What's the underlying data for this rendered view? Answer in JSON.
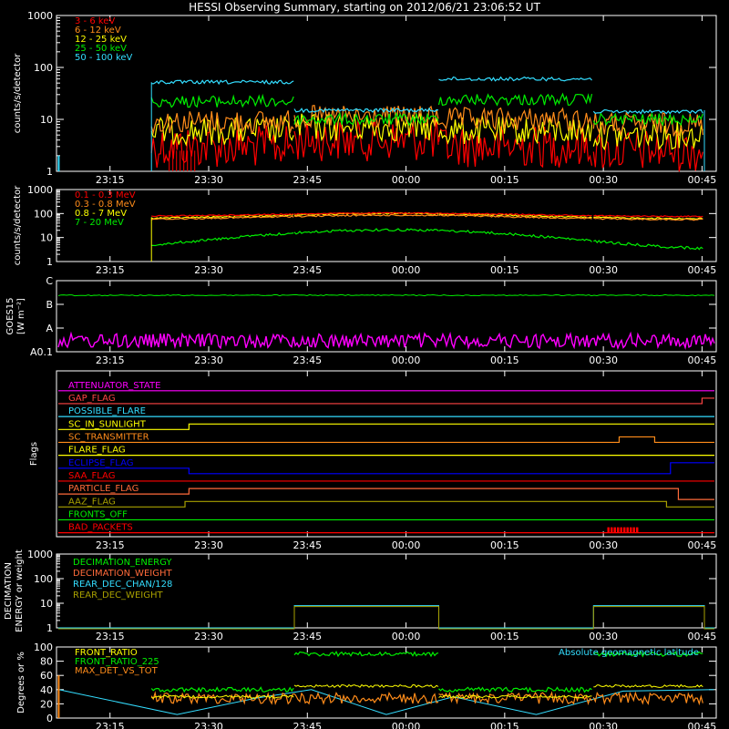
{
  "title": "HESSI Observing Summary, starting on 2012/06/21 23:06:52 UT",
  "time_ticks": [
    "23:15",
    "23:30",
    "23:45",
    "00:00",
    "00:15",
    "00:30",
    "00:45"
  ],
  "colors": {
    "red": "#ff0000",
    "orange": "#ff8c1a",
    "yellow": "#ffff00",
    "green": "#00ee00",
    "cyan": "#33ddff",
    "magenta": "#ff00ff",
    "blue": "#0000ff",
    "olive": "#a8a000",
    "white": "#ffffff",
    "brown": "#ff6a3a"
  },
  "chart_data": [
    {
      "id": "low_energy",
      "type": "line",
      "ylabel": "counts/s/detector",
      "yscale": "log",
      "ylim": [
        1,
        1000
      ],
      "yticks": [
        "1",
        "10",
        "100",
        "1000"
      ],
      "series": [
        {
          "name": "3 - 6 keV",
          "color": "#ff0000",
          "segments": [
            [
              23.35,
              1,
              2.5
            ],
            [
              23.45,
              3,
              4
            ]
          ]
        },
        {
          "name": "6 - 12 keV",
          "color": "#ff8c1a",
          "segments": [
            [
              23.35,
              8,
              10
            ]
          ]
        },
        {
          "name": "12 - 25 keV",
          "color": "#ffff00",
          "segments": [
            [
              23.35,
              5,
              6
            ]
          ]
        },
        {
          "name": "25 - 50 keV",
          "color": "#00ee00",
          "segments": [
            [
              23.35,
              20,
              25
            ],
            [
              23.72,
              10,
              12
            ],
            [
              24.04,
              22,
              28
            ],
            [
              24.47,
              10,
              12
            ]
          ]
        },
        {
          "name": "50 - 100 keV",
          "color": "#33ddff",
          "segments": [
            [
              23.35,
              50,
              55
            ],
            [
              23.72,
              15,
              18
            ],
            [
              24.04,
              60,
              62
            ],
            [
              24.47,
              15,
              17
            ]
          ]
        }
      ],
      "x_start": 23.114,
      "x_end": 24.786
    },
    {
      "id": "high_energy",
      "type": "line",
      "ylabel": "counts/s/detector",
      "yscale": "log",
      "ylim": [
        1,
        1000
      ],
      "yticks": [
        "1",
        "10",
        "100",
        "1000"
      ],
      "series": [
        {
          "name": "0.1 - 0.3 MeV",
          "color": "#ff0000",
          "levels": [
            80,
            100,
            60,
            80,
            100
          ]
        },
        {
          "name": "0.3 - 0.8 MeV",
          "color": "#ff8c1a",
          "levels": [
            60,
            70,
            60,
            70,
            80
          ]
        },
        {
          "name": "0.8 - 7 MeV",
          "color": "#ffff00",
          "levels": [
            60,
            70,
            60,
            70,
            75
          ]
        },
        {
          "name": "7 - 20 MeV",
          "color": "#00ee00",
          "levels": [
            3,
            3,
            20,
            6,
            8
          ]
        }
      ]
    },
    {
      "id": "goes",
      "type": "line",
      "ylabel": "GOES15",
      "ylabel2": "[W m⁻²]",
      "yscale": "log",
      "yticks": [
        "A0.1",
        "A",
        "B",
        "C"
      ],
      "series": [
        {
          "name": "GOES long",
          "color": "#00ee00",
          "level": "B-C"
        },
        {
          "name": "GOES short",
          "color": "#ff00ff",
          "level": "A0.1-A"
        }
      ]
    },
    {
      "id": "flags",
      "type": "table",
      "ylabel": "Flags",
      "flags": [
        {
          "name": "ATTENUATOR_STATE",
          "color": "#ff00ff"
        },
        {
          "name": "GAP_FLAG",
          "color": "#ff4444"
        },
        {
          "name": "POSSIBLE_FLARE",
          "color": "#33ddff"
        },
        {
          "name": "SC_IN_SUNLIGHT",
          "color": "#ffff00"
        },
        {
          "name": "SC_TRANSMITTER",
          "color": "#ff8c1a"
        },
        {
          "name": "FLARE_FLAG",
          "color": "#ffff00"
        },
        {
          "name": "ECLIPSE_FLAG",
          "color": "#0000ff"
        },
        {
          "name": "SAA_FLAG",
          "color": "#ff0000"
        },
        {
          "name": "PARTICLE_FLAG",
          "color": "#ff6a3a"
        },
        {
          "name": "AAZ_FLAG",
          "color": "#a8a000"
        },
        {
          "name": "FRONTS_OFF",
          "color": "#00ee00"
        },
        {
          "name": "BAD_PACKETS",
          "color": "#ff0000"
        }
      ]
    },
    {
      "id": "decimation",
      "type": "line",
      "ylabel": "DECIMATION",
      "ylabel2": "ENERGY or weight",
      "yscale": "log",
      "ylim": [
        1,
        1000
      ],
      "yticks": [
        "1",
        "10",
        "100",
        "1000"
      ],
      "series": [
        {
          "name": "DECIMATION_ENERGY",
          "color": "#00ee00"
        },
        {
          "name": "DECIMATION_WEIGHT",
          "color": "#ff6a3a"
        },
        {
          "name": "REAR_DEC_CHAN/128",
          "color": "#33ddff"
        },
        {
          "name": "REAR_DEC_WEIGHT",
          "color": "#a8a000"
        }
      ]
    },
    {
      "id": "ratios",
      "type": "line",
      "ylabel": "Degrees or %",
      "ylim": [
        0,
        100
      ],
      "yticks": [
        "0",
        "20",
        "40",
        "60",
        "80",
        "100"
      ],
      "annotation": "Absolute geomagnetic latitude",
      "series": [
        {
          "name": "FRONT_RATIO",
          "color": "#ffff00",
          "level": 40
        },
        {
          "name": "FRONT_RATIO_225",
          "color": "#00ee00",
          "level": 90
        },
        {
          "name": "MAX_DET_VS_TOT",
          "color": "#ff8c1a",
          "level": 28
        },
        {
          "name": "Absolute geomagnetic latitude",
          "color": "#33ddff"
        }
      ]
    }
  ]
}
